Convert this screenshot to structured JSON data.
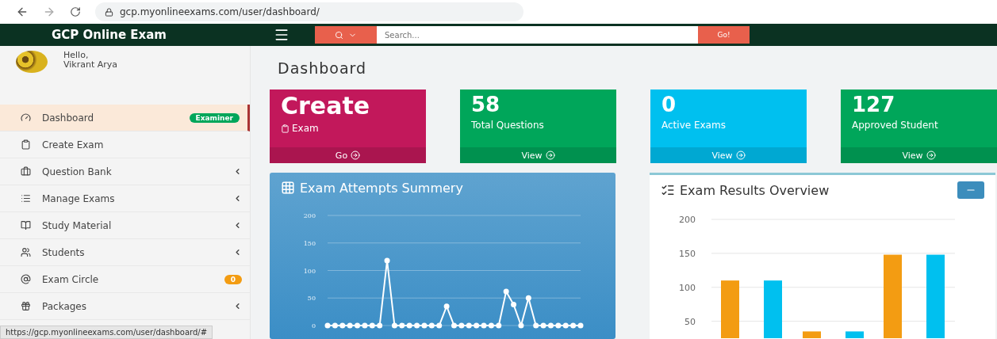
{
  "browser": {
    "url": "gcp.myonlineexams.com/user/dashboard/"
  },
  "navbar": {
    "brand": "GCP Online Exam",
    "search": {
      "placeholder": "Search...",
      "button": "Go!"
    }
  },
  "user": {
    "greeting": "Hello,",
    "name": "Vikrant Arya"
  },
  "sidebar": {
    "items": [
      {
        "label": "Dashboard",
        "selected": true,
        "expandable": false,
        "badge": {
          "text": "Examiner",
          "color": "#00a65a"
        }
      },
      {
        "label": "Create Exam",
        "selected": false,
        "expandable": false
      },
      {
        "label": "Question Bank",
        "selected": false,
        "expandable": true
      },
      {
        "label": "Manage Exams",
        "selected": false,
        "expandable": true
      },
      {
        "label": "Study Material",
        "selected": false,
        "expandable": true
      },
      {
        "label": "Students",
        "selected": false,
        "expandable": true
      },
      {
        "label": "Exam Circle",
        "selected": false,
        "expandable": false,
        "badge": {
          "text": "0",
          "color": "#f39c12"
        }
      },
      {
        "label": "Packages",
        "selected": false,
        "expandable": true
      }
    ]
  },
  "page": {
    "title": "Dashboard"
  },
  "cards": [
    {
      "kind": "action",
      "value": "Create",
      "label": "Exam",
      "link": "Go",
      "color": "#c2185b"
    },
    {
      "kind": "stat",
      "value": "58",
      "label": "Total Questions",
      "link": "View",
      "color": "#00a65a"
    },
    {
      "kind": "stat",
      "value": "0",
      "label": "Active Exams",
      "link": "View",
      "color": "#00c0ef"
    },
    {
      "kind": "stat",
      "value": "127",
      "label": "Approved Student",
      "link": "View",
      "color": "#00a65a"
    }
  ],
  "attempts_chart": {
    "title": "Exam Attempts Summery",
    "chart_data": {
      "type": "line",
      "grid": true,
      "marker": true,
      "ylim": [
        0,
        200
      ],
      "yticks": [
        0,
        50,
        100,
        150,
        200
      ],
      "values": [
        0,
        0,
        0,
        0,
        0,
        0,
        0,
        0,
        118,
        0,
        0,
        0,
        0,
        0,
        0,
        0,
        35,
        0,
        0,
        0,
        0,
        0,
        0,
        0,
        62,
        38,
        0,
        50,
        0,
        0,
        0,
        0,
        0,
        0,
        0
      ]
    }
  },
  "results_chart": {
    "title": "Exam Results Overview",
    "chart_data": {
      "type": "bar",
      "stacked": false,
      "grid": true,
      "ylim": [
        25,
        200
      ],
      "yticks": [
        50,
        100,
        150,
        200
      ],
      "series": [
        {
          "color": "#f39c12",
          "values": [
            110,
            35,
            148
          ]
        },
        {
          "color": "#00c0ef",
          "values": [
            110,
            35,
            148
          ]
        }
      ]
    }
  },
  "status_url": "https://gcp.myonlineexams.com/user/dashboard/#"
}
